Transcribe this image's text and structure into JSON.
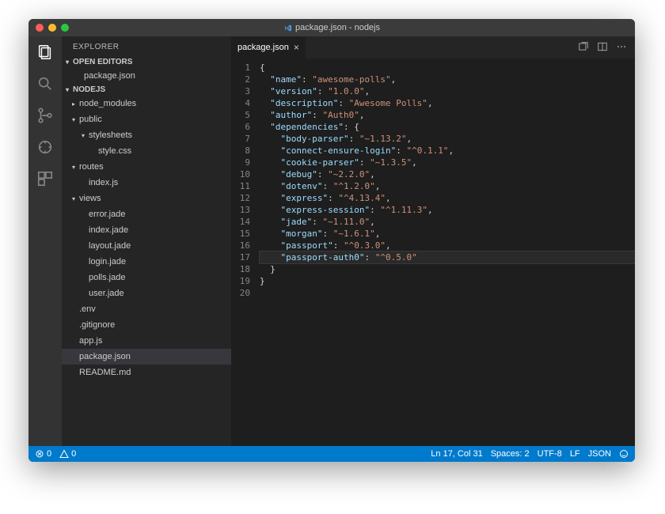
{
  "window": {
    "title": "package.json - nodejs"
  },
  "sidebar": {
    "header": "EXPLORER",
    "sections": {
      "open_editors": {
        "label": "OPEN EDITORS",
        "items": [
          "package.json"
        ]
      },
      "project": {
        "label": "NODEJS"
      }
    },
    "project_tree": [
      {
        "d": 0,
        "t": "folder",
        "exp": false,
        "label": "node_modules"
      },
      {
        "d": 0,
        "t": "folder",
        "exp": true,
        "label": "public"
      },
      {
        "d": 1,
        "t": "folder",
        "exp": true,
        "label": "stylesheets"
      },
      {
        "d": 2,
        "t": "file",
        "label": "style.css"
      },
      {
        "d": 0,
        "t": "folder",
        "exp": true,
        "label": "routes"
      },
      {
        "d": 1,
        "t": "file",
        "label": "index.js"
      },
      {
        "d": 0,
        "t": "folder",
        "exp": true,
        "label": "views"
      },
      {
        "d": 1,
        "t": "file",
        "label": "error.jade"
      },
      {
        "d": 1,
        "t": "file",
        "label": "index.jade"
      },
      {
        "d": 1,
        "t": "file",
        "label": "layout.jade"
      },
      {
        "d": 1,
        "t": "file",
        "label": "login.jade"
      },
      {
        "d": 1,
        "t": "file",
        "label": "polls.jade"
      },
      {
        "d": 1,
        "t": "file",
        "label": "user.jade"
      },
      {
        "d": 0,
        "t": "file",
        "label": ".env"
      },
      {
        "d": 0,
        "t": "file",
        "label": ".gitignore"
      },
      {
        "d": 0,
        "t": "file",
        "label": "app.js"
      },
      {
        "d": 0,
        "t": "file",
        "label": "package.json",
        "selected": true
      },
      {
        "d": 0,
        "t": "file",
        "label": "README.md"
      }
    ]
  },
  "editor": {
    "tab": "package.json",
    "highlight_line": 17,
    "code": [
      [
        {
          "c": "b",
          "t": "{"
        }
      ],
      [
        {
          "c": "p",
          "t": "  "
        },
        {
          "c": "k",
          "t": "\"name\""
        },
        {
          "c": "p",
          "t": ": "
        },
        {
          "c": "s",
          "t": "\"awesome-polls\""
        },
        {
          "c": "p",
          "t": ","
        }
      ],
      [
        {
          "c": "p",
          "t": "  "
        },
        {
          "c": "k",
          "t": "\"version\""
        },
        {
          "c": "p",
          "t": ": "
        },
        {
          "c": "s",
          "t": "\"1.0.0\""
        },
        {
          "c": "p",
          "t": ","
        }
      ],
      [
        {
          "c": "p",
          "t": "  "
        },
        {
          "c": "k",
          "t": "\"description\""
        },
        {
          "c": "p",
          "t": ": "
        },
        {
          "c": "s",
          "t": "\"Awesome Polls\""
        },
        {
          "c": "p",
          "t": ","
        }
      ],
      [
        {
          "c": "p",
          "t": "  "
        },
        {
          "c": "k",
          "t": "\"author\""
        },
        {
          "c": "p",
          "t": ": "
        },
        {
          "c": "s",
          "t": "\"Auth0\""
        },
        {
          "c": "p",
          "t": ","
        }
      ],
      [
        {
          "c": "p",
          "t": "  "
        },
        {
          "c": "k",
          "t": "\"dependencies\""
        },
        {
          "c": "p",
          "t": ": "
        },
        {
          "c": "b",
          "t": "{"
        }
      ],
      [
        {
          "c": "p",
          "t": "    "
        },
        {
          "c": "k",
          "t": "\"body-parser\""
        },
        {
          "c": "p",
          "t": ": "
        },
        {
          "c": "s",
          "t": "\"~1.13.2\""
        },
        {
          "c": "p",
          "t": ","
        }
      ],
      [
        {
          "c": "p",
          "t": "    "
        },
        {
          "c": "k",
          "t": "\"connect-ensure-login\""
        },
        {
          "c": "p",
          "t": ": "
        },
        {
          "c": "s",
          "t": "\"^0.1.1\""
        },
        {
          "c": "p",
          "t": ","
        }
      ],
      [
        {
          "c": "p",
          "t": "    "
        },
        {
          "c": "k",
          "t": "\"cookie-parser\""
        },
        {
          "c": "p",
          "t": ": "
        },
        {
          "c": "s",
          "t": "\"~1.3.5\""
        },
        {
          "c": "p",
          "t": ","
        }
      ],
      [
        {
          "c": "p",
          "t": "    "
        },
        {
          "c": "k",
          "t": "\"debug\""
        },
        {
          "c": "p",
          "t": ": "
        },
        {
          "c": "s",
          "t": "\"~2.2.0\""
        },
        {
          "c": "p",
          "t": ","
        }
      ],
      [
        {
          "c": "p",
          "t": "    "
        },
        {
          "c": "k",
          "t": "\"dotenv\""
        },
        {
          "c": "p",
          "t": ": "
        },
        {
          "c": "s",
          "t": "\"^1.2.0\""
        },
        {
          "c": "p",
          "t": ","
        }
      ],
      [
        {
          "c": "p",
          "t": "    "
        },
        {
          "c": "k",
          "t": "\"express\""
        },
        {
          "c": "p",
          "t": ": "
        },
        {
          "c": "s",
          "t": "\"^4.13.4\""
        },
        {
          "c": "p",
          "t": ","
        }
      ],
      [
        {
          "c": "p",
          "t": "    "
        },
        {
          "c": "k",
          "t": "\"express-session\""
        },
        {
          "c": "p",
          "t": ": "
        },
        {
          "c": "s",
          "t": "\"^1.11.3\""
        },
        {
          "c": "p",
          "t": ","
        }
      ],
      [
        {
          "c": "p",
          "t": "    "
        },
        {
          "c": "k",
          "t": "\"jade\""
        },
        {
          "c": "p",
          "t": ": "
        },
        {
          "c": "s",
          "t": "\"~1.11.0\""
        },
        {
          "c": "p",
          "t": ","
        }
      ],
      [
        {
          "c": "p",
          "t": "    "
        },
        {
          "c": "k",
          "t": "\"morgan\""
        },
        {
          "c": "p",
          "t": ": "
        },
        {
          "c": "s",
          "t": "\"~1.6.1\""
        },
        {
          "c": "p",
          "t": ","
        }
      ],
      [
        {
          "c": "p",
          "t": "    "
        },
        {
          "c": "k",
          "t": "\"passport\""
        },
        {
          "c": "p",
          "t": ": "
        },
        {
          "c": "s",
          "t": "\"^0.3.0\""
        },
        {
          "c": "p",
          "t": ","
        }
      ],
      [
        {
          "c": "p",
          "t": "    "
        },
        {
          "c": "k",
          "t": "\"passport-auth0\""
        },
        {
          "c": "p",
          "t": ": "
        },
        {
          "c": "s",
          "t": "\"^0.5.0\""
        }
      ],
      [
        {
          "c": "p",
          "t": "  "
        },
        {
          "c": "b",
          "t": "}"
        }
      ],
      [
        {
          "c": "b",
          "t": "}"
        }
      ],
      []
    ]
  },
  "statusbar": {
    "errors": "0",
    "warnings": "0",
    "cursor": "Ln 17, Col 31",
    "spaces": "Spaces: 2",
    "encoding": "UTF-8",
    "eol": "LF",
    "lang": "JSON"
  }
}
